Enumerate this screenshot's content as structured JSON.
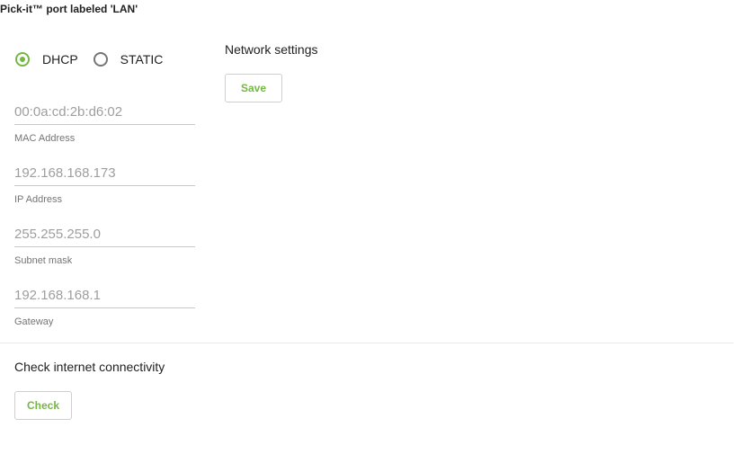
{
  "port_title": "Pick-it™ port labeled 'LAN'",
  "mode": {
    "options": [
      {
        "label": "DHCP",
        "selected": true
      },
      {
        "label": "STATIC",
        "selected": false
      }
    ]
  },
  "fields": {
    "mac": {
      "value": "00:0a:cd:2b:d6:02",
      "caption": "MAC Address"
    },
    "ip": {
      "value": "192.168.168.173",
      "caption": "IP Address"
    },
    "subnet": {
      "value": "255.255.255.0",
      "caption": "Subnet mask"
    },
    "gateway": {
      "value": "192.168.168.1",
      "caption": "Gateway"
    }
  },
  "network_settings": {
    "heading": "Network settings",
    "save_label": "Save"
  },
  "connectivity": {
    "heading": "Check internet connectivity",
    "check_label": "Check"
  },
  "colors": {
    "accent": "#74b843",
    "muted_text": "#9e9e9e",
    "caption_text": "#757575"
  }
}
